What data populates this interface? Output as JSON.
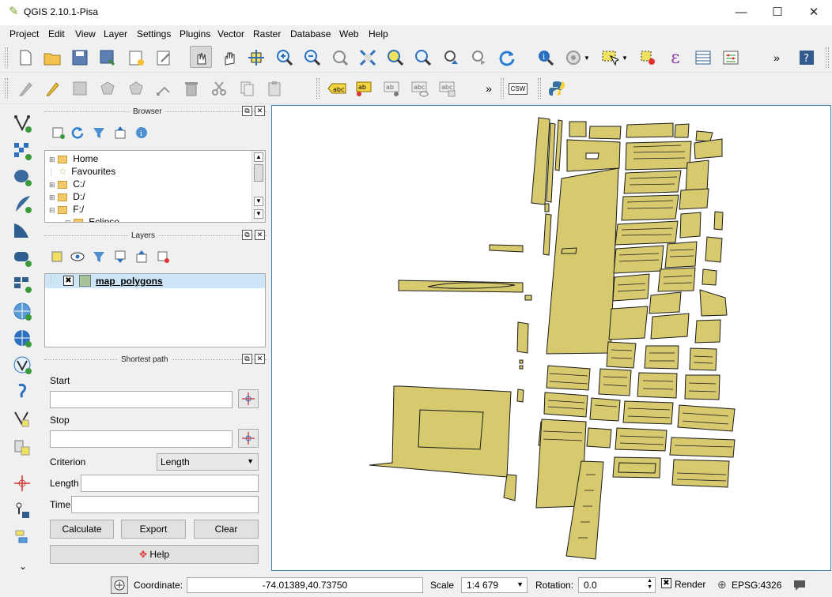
{
  "window": {
    "title": "QGIS 2.10.1-Pisa"
  },
  "menu": [
    "Project",
    "Edit",
    "View",
    "Layer",
    "Settings",
    "Plugins",
    "Vector",
    "Raster",
    "Database",
    "Web",
    "Help"
  ],
  "browser": {
    "title": "Browser",
    "items": [
      "Home",
      "Favourites",
      "C:/",
      "D:/",
      "F:/",
      "Eclipse"
    ]
  },
  "layers": {
    "title": "Layers",
    "items": [
      {
        "name": "map_polygons",
        "checked_mark": "✖"
      }
    ]
  },
  "shortest_path": {
    "title": "Shortest path",
    "start_label": "Start",
    "stop_label": "Stop",
    "start_value": "",
    "stop_value": "",
    "criterion_label": "Criterion",
    "criterion_value": "Length",
    "length_label": "Length",
    "time_label": "Time",
    "length_value": "",
    "time_value": "",
    "calculate": "Calculate",
    "export": "Export",
    "clear": "Clear",
    "help": "Help"
  },
  "toolbar_labels": {
    "more1": "»",
    "more2": "»",
    "csw": "CSW",
    "abc": "abc"
  },
  "status": {
    "coordinate_label": "Coordinate:",
    "coordinate_value": "-74.01389,40.73750",
    "scale_label": "Scale",
    "scale_value": "1:4 679",
    "rotation_label": "Rotation:",
    "rotation_value": "0.0",
    "render_label": "Render",
    "render_mark": "✖",
    "crs": "EPSG:4326"
  },
  "colors": {
    "polygon_fill": "#d6c96e",
    "polygon_stroke": "#1a1a1a",
    "canvas_border": "#3c7fb1",
    "layer_swatch": "#a5c49a"
  }
}
